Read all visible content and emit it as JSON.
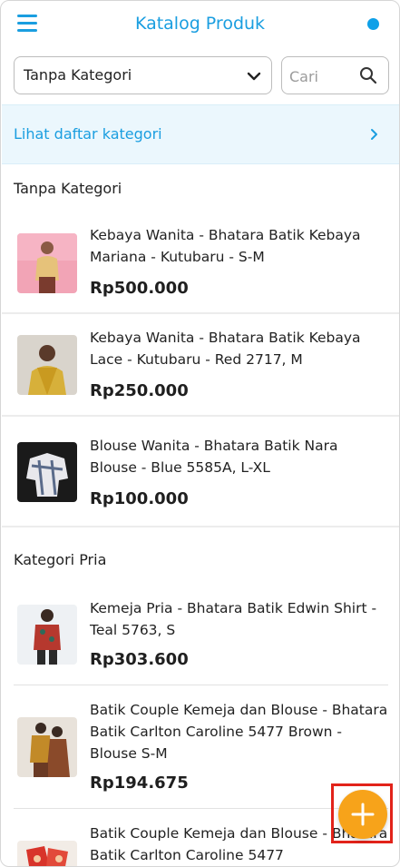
{
  "header": {
    "title": "Katalog Produk",
    "menu_icon": "hamburger-menu-icon",
    "status_dot_color": "#0ea0e8"
  },
  "filters": {
    "category_value": "Tanpa Kategori",
    "search_placeholder": "Cari"
  },
  "banner": {
    "label": "Lihat daftar kategori"
  },
  "sections": [
    {
      "title": "Tanpa Kategori",
      "products": [
        {
          "name": "Kebaya Wanita - Bhatara Batik Kebaya Mariana - Kutubaru - S-M",
          "price": "Rp500.000"
        },
        {
          "name": "Kebaya Wanita - Bhatara Batik Kebaya Lace - Kutubaru - Red 2717, M",
          "price": "Rp250.000"
        },
        {
          "name": "Blouse Wanita - Bhatara Batik Nara Blouse - Blue 5585A, L-XL",
          "price": "Rp100.000"
        }
      ]
    },
    {
      "title": "Kategori Pria",
      "products": [
        {
          "name": "Kemeja Pria - Bhatara Batik Edwin Shirt - Teal 5763, S",
          "price": "Rp303.600"
        },
        {
          "name": "Batik Couple Kemeja dan Blouse - Bhatara Batik Carlton Caroline 5477 Brown - Blouse S-M",
          "price": "Rp194.675"
        },
        {
          "name": "Batik Couple Kemeja dan Blouse - Bhatara Batik Carlton Caroline 5477",
          "price": ""
        }
      ]
    }
  ],
  "fab": {
    "icon": "plus-icon",
    "color": "#f7a31a"
  }
}
